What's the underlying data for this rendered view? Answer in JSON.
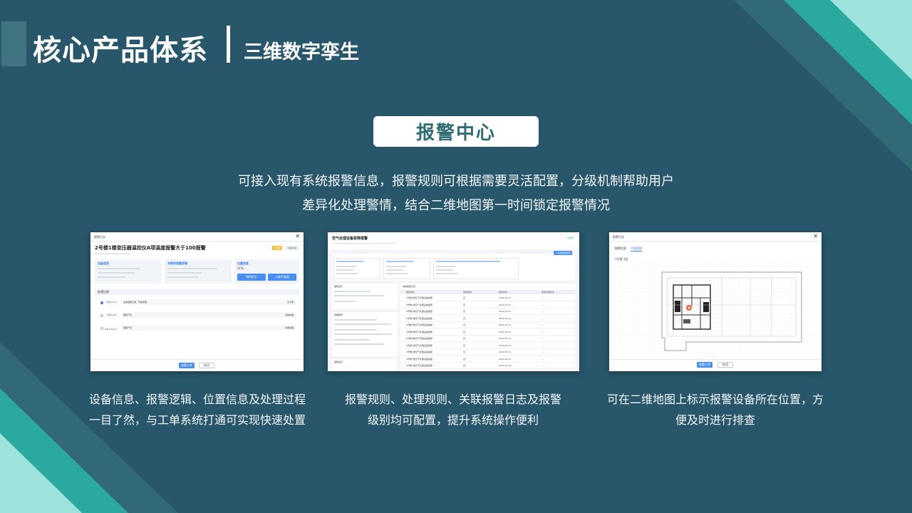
{
  "header": {
    "title": "核心产品体系",
    "subtitle": "三维数字孪生"
  },
  "section_badge": "报警中心",
  "intro": {
    "line1": "可接入现有系统报警信息，报警规则可根据需要灵活配置，分级机制帮助用户",
    "line2": "差异化处理警情，结合二维地图第一时间锁定报警情况"
  },
  "shot1": {
    "window_title": "报警日志",
    "close": "✕",
    "heading": "2号楼1楼变压器温控仪A项温度报警大于100报警",
    "tag_level": "一般",
    "tag_status": "处理过程",
    "card_device": "设备信息",
    "card_logic": "关联的报警逻辑",
    "card_location": "位置信息",
    "location_value": "1F1L",
    "btn_bim": "BIM定位",
    "btn_map": "二维平面图",
    "process_title": "处理过程",
    "process_rows": [
      {
        "time": "今天10:31",
        "text": "生成运维工单，开始处理",
        "link": "王小明"
      },
      {
        "time": "今天09:51",
        "text": "报警产生",
        "link": "系统处理"
      },
      {
        "time": "2019.10.21",
        "text": "报警产生",
        "link": "系统处理"
      }
    ],
    "btn_primary": "查看工单",
    "btn_cancel": "取消"
  },
  "shot2": {
    "window_title": "空气处理设备故障报警",
    "status": "已启用",
    "btn_add": "+ 新增报警规则",
    "left_panel_1": "报警显示",
    "left_panel_2": "处理规则",
    "left_panel_3": "报警显示",
    "table_title": "关联报警日志",
    "table_headers": [
      "报警源名",
      "报警级别",
      "报警时间",
      "报警处理状态"
    ],
    "table_rows": [
      [
        "2号楼1楼空气处理设备故障",
        "高",
        "2019.10.21",
        "—"
      ],
      [
        "2号楼1楼空气处理设备故障",
        "高",
        "2019.10.21",
        "—"
      ],
      [
        "2号楼1楼空气处理设备故障",
        "高",
        "2019.10.21",
        "—"
      ],
      [
        "2号楼1楼空气处理设备故障",
        "高",
        "2019.10.21",
        "—"
      ],
      [
        "2号楼1楼空气处理设备故障",
        "高",
        "2019.10.21",
        "—"
      ],
      [
        "2号楼1楼空气处理设备故障",
        "高",
        "2019.10.21",
        "—"
      ],
      [
        "2号楼1楼空气处理设备故障",
        "高",
        "2019.10.21",
        "—"
      ],
      [
        "2号楼1楼空气处理设备故障",
        "高",
        "2019.10.21",
        "—"
      ],
      [
        "2号楼1楼空气处理设备故障",
        "高",
        "2019.10.21",
        "—"
      ],
      [
        "2号楼1楼空气处理设备故障",
        "高",
        "2019.10.21",
        "—"
      ],
      [
        "2号楼1楼空气处理设备故障",
        "高",
        "2019.10.21",
        "—"
      ]
    ]
  },
  "shot3": {
    "window_title": "报警日志",
    "close": "✕",
    "tab_1": "报警信息",
    "tab_2": "平面地图",
    "floor_label": "1号楼 1层",
    "btn_primary": "查看工单",
    "btn_cancel": "取消"
  },
  "captions": {
    "c1_l1": "设备信息、报警逻辑、位置信息及处理过程",
    "c1_l2": "一目了然，与工单系统打通可实现快速处置",
    "c2_l1": "报警规则、处理规则、关联报警日志及报警",
    "c2_l2": "级别均可配置，提升系统操作便利",
    "c3_l1": "可在二维地图上标示报警设备所在位置，方",
    "c3_l2": "便及时进行排查"
  },
  "colors": {
    "background": "#28566b",
    "accent_teal": "#2ba99e",
    "accent_light": "#9fe3dd",
    "badge_text": "#2f6d74",
    "ui_blue": "#4a8ff0"
  }
}
